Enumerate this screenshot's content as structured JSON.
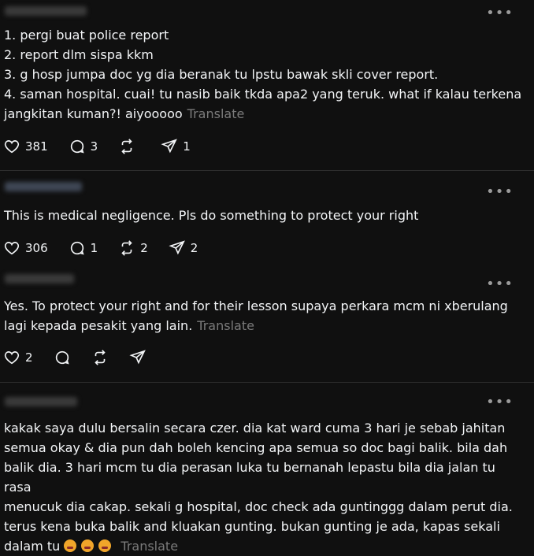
{
  "posts": [
    {
      "lines": [
        "1. pergi buat police report",
        "2. report dlm sispa kkm",
        "3. g hosp jumpa doc yg dia beranak tu lpstu bawak skli cover report.",
        "4. saman hospital. cuai! tu nasib baik tkda apa2 yang teruk. what if kalau terkena",
        "jangkitan kuman?! aiyooooo"
      ],
      "translate": "Translate",
      "likes": "381",
      "replies": "3",
      "reposts": "",
      "shares": "1"
    },
    {
      "lines": [
        "This is medical negligence. Pls do something to protect your right"
      ],
      "translate": "",
      "likes": "306",
      "replies": "1",
      "reposts": "2",
      "shares": "2"
    },
    {
      "lines": [
        "Yes. To protect your right and for their lesson supaya perkara mcm ni xberulang",
        "lagi kepada pesakit yang lain."
      ],
      "translate": "Translate",
      "likes": "2",
      "replies": "",
      "reposts": "",
      "shares": ""
    },
    {
      "lines": [
        "kakak saya dulu bersalin secara czer. dia kat ward cuma 3 hari je sebab jahitan",
        "semua okay & dia pun dah boleh kencing apa semua so doc bagi balik. bila dah",
        "balik dia. 3 hari mcm tu dia perasan luka tu bernanah lepastu bila dia jalan tu rasa",
        "menucuk dia cakap. sekali g hospital, doc check ada guntinggg dalam perut dia.",
        "terus kena buka balik and kluakan gunting. bukan gunting je ada, kapas sekali",
        "dalam tu"
      ],
      "translate": "Translate",
      "emoji_count": 3,
      "emoji_name": "persevering-face-emoji"
    }
  ],
  "icons": {
    "more": "more-options-icon",
    "like": "heart-icon",
    "reply": "comment-icon",
    "repost": "repost-icon",
    "share": "share-icon"
  },
  "colors": {
    "background": "#101010",
    "text": "#f3f5f7",
    "muted": "#7a7a7a",
    "divider": "#2d2d2d"
  }
}
